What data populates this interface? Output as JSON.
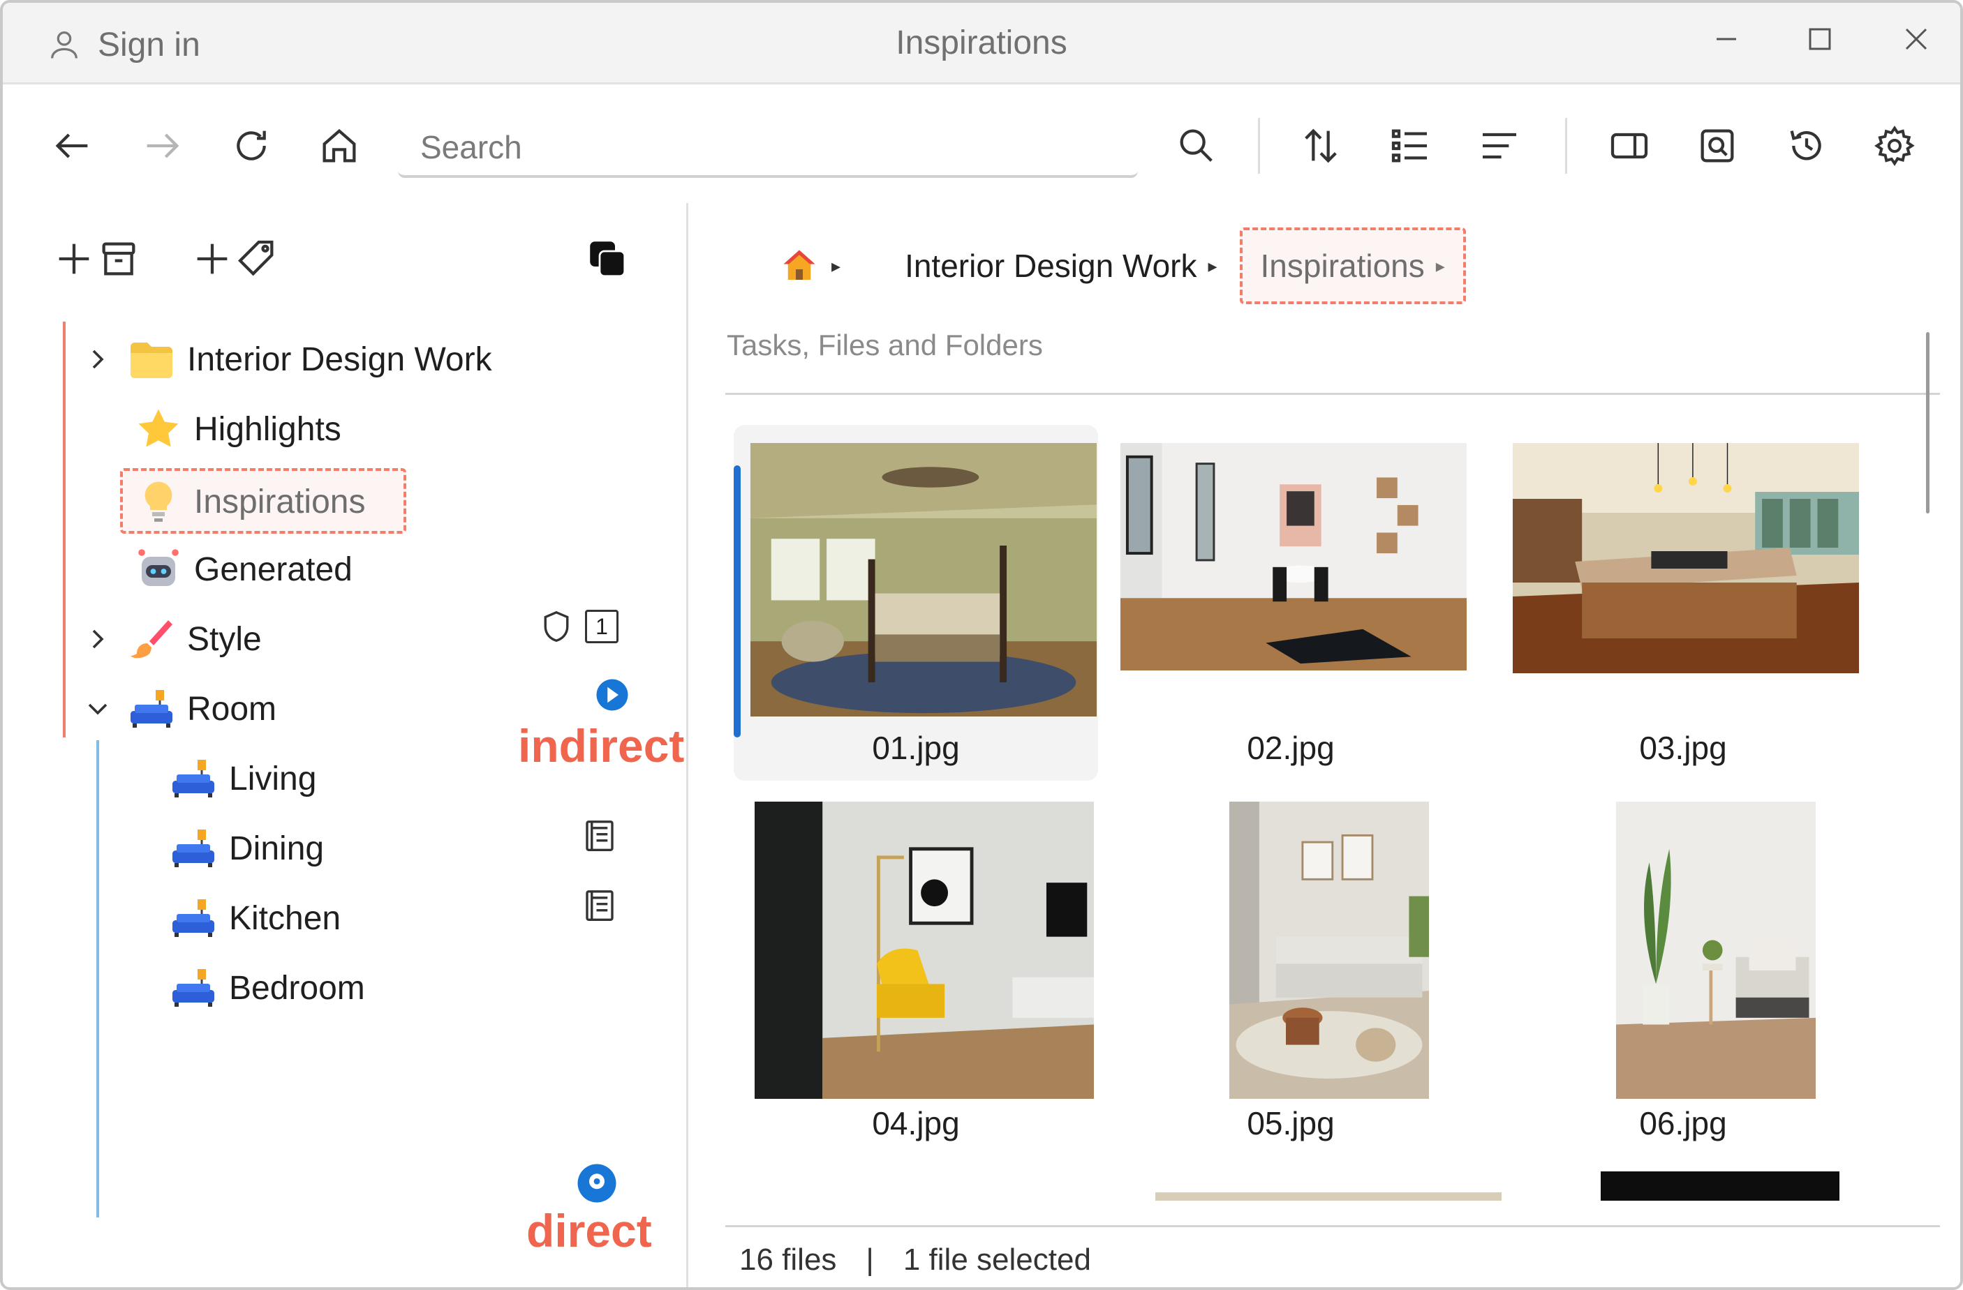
{
  "window": {
    "title": "Inspirations",
    "sign_in_label": "Sign in",
    "controls": [
      "minimize-icon",
      "maximize-icon",
      "close-icon"
    ]
  },
  "toolbar": {
    "search_placeholder": "Search",
    "buttons": [
      "back-icon",
      "forward-icon",
      "refresh-icon",
      "home-icon",
      "search-icon",
      "sort-icon",
      "list-view-icon",
      "details-view-icon",
      "panel-toggle-icon",
      "preview-icon",
      "history-icon",
      "settings-icon"
    ]
  },
  "sidebar": {
    "tools": [
      "add-icon",
      "archive-icon",
      "add-icon",
      "tag-icon",
      "sync-icon"
    ],
    "tree": [
      {
        "label": "Interior Design Work",
        "icon": "folder-icon",
        "expandable": true,
        "expanded": false
      },
      {
        "label": "Highlights",
        "icon": "star-icon",
        "badge": "1"
      },
      {
        "label": "Inspirations",
        "icon": "lightbulb-icon",
        "selected": true
      },
      {
        "label": "Generated",
        "icon": "robot-icon"
      },
      {
        "label": "Style",
        "icon": "paintbrush-icon",
        "expandable": true,
        "expanded": false
      },
      {
        "label": "Room",
        "icon": "sofa-icon",
        "expandable": true,
        "expanded": true
      },
      {
        "label": "Living",
        "icon": "sofa-icon"
      },
      {
        "label": "Dining",
        "icon": "sofa-icon"
      },
      {
        "label": "Kitchen",
        "icon": "sofa-icon"
      },
      {
        "label": "Bedroom",
        "icon": "sofa-icon"
      }
    ],
    "annotations": {
      "indirect": "indirect",
      "direct": "direct"
    }
  },
  "main": {
    "breadcrumb": [
      "Interior Design Work",
      "Inspirations"
    ],
    "section_label": "Tasks, Files and Folders",
    "files": [
      {
        "name": "01.jpg",
        "selected": true
      },
      {
        "name": "02.jpg"
      },
      {
        "name": "03.jpg"
      },
      {
        "name": "04.jpg"
      },
      {
        "name": "05.jpg"
      },
      {
        "name": "06.jpg"
      }
    ],
    "status": {
      "count": "16 files",
      "separator": "|",
      "selection": "1 file selected"
    }
  },
  "colors": {
    "accent_blue": "#1f6fd1",
    "highlight_red": "#f07e6a",
    "annotation_red": "#f0654e"
  }
}
